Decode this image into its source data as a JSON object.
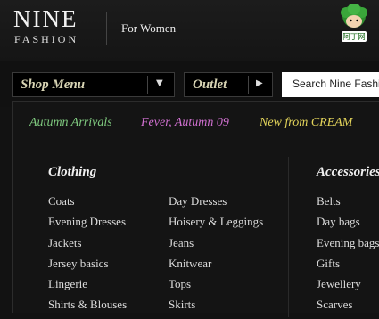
{
  "header": {
    "logo_main": "NINE",
    "logo_sub": "FASHION",
    "section_label": "For Women",
    "badge_text": "阿丁网"
  },
  "nav": {
    "shop_menu": "Shop Menu",
    "outlet": "Outlet",
    "search_placeholder": "Search Nine Fashion"
  },
  "featured_links": [
    {
      "label": "Autumn Arrivals",
      "color": "#7fc97f"
    },
    {
      "label": "Fever, Autumn 09",
      "color": "#d070d0"
    },
    {
      "label": "New from CREAM",
      "color": "#e2d35a"
    }
  ],
  "categories": {
    "clothing": {
      "heading": "Clothing",
      "col1": [
        "Coats",
        "Evening Dresses",
        "Jackets",
        "Jersey basics",
        "Lingerie",
        "Shirts & Blouses"
      ],
      "col2": [
        "Day Dresses",
        "Hoisery & Leggings",
        "Jeans",
        "Knitwear",
        "Tops",
        "Skirts"
      ]
    },
    "accessories": {
      "heading": "Accessories",
      "items": [
        "Belts",
        "Day bags",
        "Evening bags",
        "Gifts",
        "Jewellery",
        "Scarves"
      ]
    }
  }
}
